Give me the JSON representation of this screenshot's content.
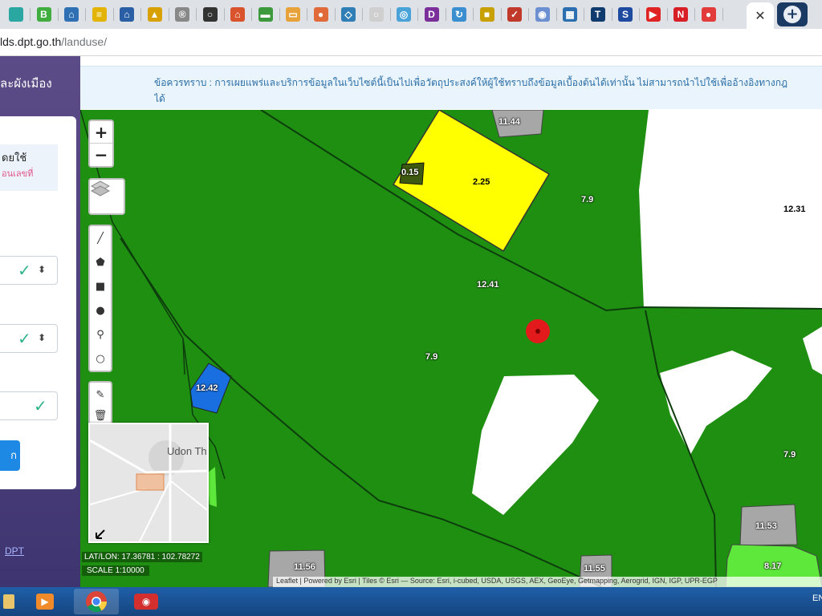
{
  "browser": {
    "tabs": [
      {
        "icon": "map-favicon",
        "glyph": "",
        "color": "#2aa7a1"
      },
      {
        "icon": "b-favicon",
        "glyph": "B",
        "color": "#3fae3f"
      },
      {
        "icon": "home-favicon",
        "glyph": "⌂",
        "color": "#2f6fb4"
      },
      {
        "icon": "flag-favicon",
        "glyph": "≡",
        "color": "#e2b400"
      },
      {
        "icon": "house-favicon",
        "glyph": "⌂",
        "color": "#2a5fa6"
      },
      {
        "icon": "chart-favicon",
        "glyph": "▲",
        "color": "#d8a100"
      },
      {
        "icon": "r-logo-favicon",
        "glyph": "®",
        "color": "#888888"
      },
      {
        "icon": "chat-favicon",
        "glyph": "○",
        "color": "#333333"
      },
      {
        "icon": "home2-favicon",
        "glyph": "⌂",
        "color": "#d9532c"
      },
      {
        "icon": "money-favicon",
        "glyph": "▬",
        "color": "#3c9a3c"
      },
      {
        "icon": "card-favicon",
        "glyph": "▭",
        "color": "#e8a23a"
      },
      {
        "icon": "person-favicon",
        "glyph": "●",
        "color": "#e06a3a"
      },
      {
        "icon": "shield-favicon",
        "glyph": "◇",
        "color": "#2f7fb6"
      },
      {
        "icon": "search-favicon",
        "glyph": "○",
        "color": "#cfcfcf"
      },
      {
        "icon": "globe-favicon",
        "glyph": "◎",
        "color": "#4aa3d8"
      },
      {
        "icon": "d-favicon",
        "glyph": "D",
        "color": "#7a2f9a"
      },
      {
        "icon": "refresh-favicon",
        "glyph": "↻",
        "color": "#3b8fd0"
      },
      {
        "icon": "emblem-favicon",
        "glyph": "■",
        "color": "#c8a000"
      },
      {
        "icon": "badge-favicon",
        "glyph": "✓",
        "color": "#c0392b"
      },
      {
        "icon": "circle-favicon",
        "glyph": "◉",
        "color": "#6b8fd0"
      },
      {
        "icon": "grid-favicon",
        "glyph": "▦",
        "color": "#2c6fb0"
      },
      {
        "icon": "t-favicon",
        "glyph": "T",
        "color": "#0f3b6e"
      },
      {
        "icon": "s-favicon",
        "glyph": "S",
        "color": "#1e4aa0"
      },
      {
        "icon": "youtube-favicon",
        "glyph": "▶",
        "color": "#e02424"
      },
      {
        "icon": "netflix-favicon",
        "glyph": "N",
        "color": "#d81f26"
      },
      {
        "icon": "maps-pin-favicon",
        "glyph": "●",
        "color": "#e23b3b"
      }
    ],
    "close_glyph": "✕",
    "new_tab_glyph": "+",
    "url_host": "lds.dpt.go.th",
    "url_path": "/landuse/"
  },
  "sidebar": {
    "title": "ละผังเมือง",
    "note_line1": "ดยใช้",
    "note_line2": "อนเลขที่",
    "search_label": "ก",
    "footer_link": "DPT"
  },
  "notice": {
    "text": "ข้อควรทราบ : การเผยแพร่และบริการข้อมูลในเว็บไซต์นี้เป็นไปเพื่อวัตถุประสงค์ให้ผู้ใช้ทราบถึงข้อมูลเบื้องต้นได้เท่านั้น ไม่สามารถนำไปใช้เพื่ออ้างอิงทางกฎ",
    "text_line2": "ได้"
  },
  "map": {
    "parcel_labels": [
      {
        "id": "p-1144",
        "text": "11.44"
      },
      {
        "id": "p-015",
        "text": "0.15"
      },
      {
        "id": "p-225",
        "text": "2.25"
      },
      {
        "id": "p-79a",
        "text": "7.9"
      },
      {
        "id": "p-1231",
        "text": "12.31"
      },
      {
        "id": "p-1241",
        "text": "12.41"
      },
      {
        "id": "p-79b",
        "text": "7.9"
      },
      {
        "id": "p-1242",
        "text": "12.42"
      },
      {
        "id": "p-79c",
        "text": "7.9"
      },
      {
        "id": "p-1153",
        "text": "11.53"
      },
      {
        "id": "p-817",
        "text": "8.17"
      },
      {
        "id": "p-1156",
        "text": "11.56"
      },
      {
        "id": "p-1155",
        "text": "11.55"
      }
    ],
    "minimap_label": "Udon Th",
    "latlon": "LAT/LON: 17.36781 : 102.78272",
    "scale": "SCALE 1:10000",
    "attribution": "Leaflet | Powered by Esri | Tiles © Esri — Source: Esri, i-cubed, USDA, USGS, AEX, GeoEye, Getmapping, Aerogrid, IGN, IGP, UPR-EGP",
    "zoom_in": "+",
    "zoom_out": "−",
    "colors": {
      "agriculture": "#1f8f12",
      "residential": "#ffff00",
      "government": "#1a6fe0",
      "light_green": "#5fe83c",
      "grey": "#a7a7a7",
      "marker": "#e31a1c"
    }
  },
  "taskbar": {
    "lang": "EN"
  }
}
